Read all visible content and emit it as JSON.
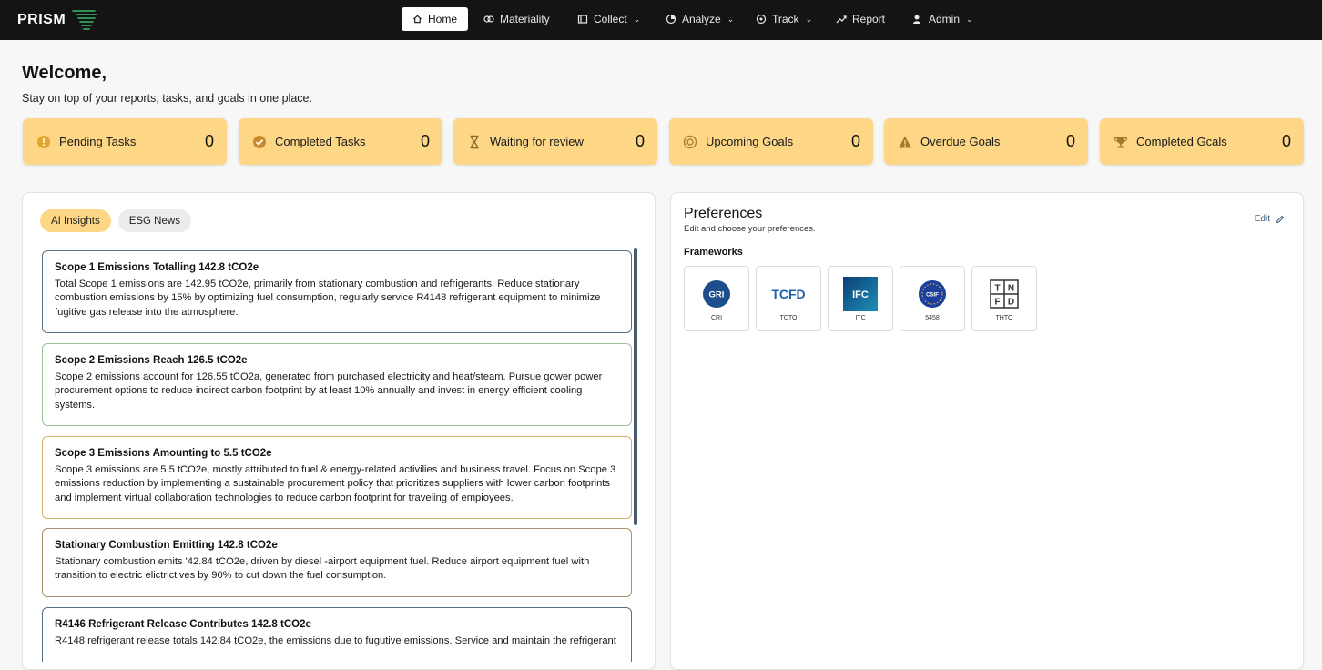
{
  "brand": {
    "name": "PRISM"
  },
  "nav": {
    "home": "Home",
    "materiality": "Materiality",
    "collect": "Collect",
    "analyze": "Analyze",
    "track": "Track",
    "report": "Report",
    "admin": "Admin"
  },
  "header": {
    "welcome": "Welcome,",
    "subtitle": "Stay on top of your reports, tasks, and goals in one place."
  },
  "stats": [
    {
      "label": "Pending Tasks",
      "value": "0",
      "icon": "info-circle-icon"
    },
    {
      "label": "Completed Tasks",
      "value": "0",
      "icon": "check-circle-icon"
    },
    {
      "label": "Waiting for review",
      "value": "0",
      "icon": "hourglass-icon"
    },
    {
      "label": "Upcoming Goals",
      "value": "0",
      "icon": "target-icon"
    },
    {
      "label": "Overdue Goals",
      "value": "0",
      "icon": "warning-icon"
    },
    {
      "label": "Completed Gcals",
      "value": "0",
      "icon": "trophy-icon"
    }
  ],
  "tabs": {
    "ai_insights": "AI Insights",
    "esg_news": "ESG News"
  },
  "insights": [
    {
      "title": "Scope 1 Emissions Totalling 142.8 tCO2e",
      "body": "Total Scope 1 emissions are 142.95 tCO2e, primarily from stationary combustion and refrigerants. Reduce stationary combustion emissions by 15% by optimizing fuel consumption, regularly service R4148 refrigerant equipment to minimize fugitive gas release into the atmosphere."
    },
    {
      "title": "Scope 2 Emissions Reach 126.5 tCO2e",
      "body": "Scope 2 emissions account for 126.55 tCO2a, generated from purchased electricity and heat/steam. Pursue gower power procurement options to reduce indirect carbon footprint by at least 10% annually and invest in energy efficient cooling systems."
    },
    {
      "title": "Scope 3 Emissions Amounting to 5.5 tCO2e",
      "body": "Scope 3 emissions are 5.5 tCO2e, mostly attributed to fuel & energy-related activilies and business travel. Focus on Scope 3 emissions reduction by implementing a sustainable procurement policy that prioritizes suppliers with lower carbon footprints and implement virtual collaboration technologies to reduce carbon footprint for traveling of empioyees."
    },
    {
      "title": "Stationary Combustion Emitting 142.8 tCO2e",
      "body": "Stationary combustion emits '42.84 tCO2e, driven by diesel -airport equipment fuel. Reduce airport equipment fuel with transition to electric elictrictives by 90% to cut down the fuel consumption."
    },
    {
      "title": "R4146 Refrigerant Release Contributes 142.8 tCO2e",
      "body": "R4148 refrigerant release totals 142.84 tCO2e, the emissions due to fugutive emissions. Service and maintain the refrigerant"
    }
  ],
  "preferences": {
    "title": "Preferences",
    "subtitle": "Edit and choose your preferences.",
    "edit": "Edit",
    "frameworks_label": "Frameworks",
    "frameworks": [
      {
        "name": "CRI",
        "logo_text": "GRI"
      },
      {
        "name": "TCTO",
        "logo_text": "TCFD"
      },
      {
        "name": "ITC",
        "logo_text": "IFC"
      },
      {
        "name": "5458",
        "logo_text": "CSIF"
      },
      {
        "name": "THTO",
        "logo_text": "TNFD"
      }
    ]
  },
  "colors": {
    "nav_bg": "#141414",
    "accent": "#fdd786",
    "insight_borders": [
      "#5b7488",
      "#9bc39d",
      "#d4b26c",
      "#a89070",
      "#5b6f88"
    ]
  }
}
